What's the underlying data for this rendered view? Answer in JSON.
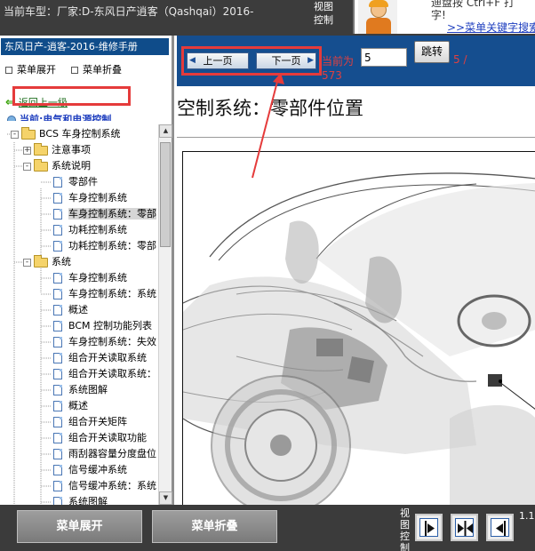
{
  "header": {
    "vehicle_title": "当前车型：厂家:D-东风日产逍客（Qashqai）2016-",
    "view_control": "视图控制",
    "promo_text": "迪盘按 Ctrl+F 打\n字!",
    "promo_link": ">>菜单关键字搜索"
  },
  "left_panel": {
    "manual_title": "东风日产-逍客-2016-维修手册",
    "menu_expand": "菜单展开",
    "menu_collapse": "菜单折叠",
    "back_link": "返回上一级",
    "current_link": "当前:电气和电源控制",
    "tree": [
      {
        "label": "BCS 车身控制系统",
        "type": "folder",
        "level": 0,
        "toggle": "-"
      },
      {
        "label": "注意事项",
        "type": "folder",
        "level": 1,
        "toggle": "+"
      },
      {
        "label": "系统说明",
        "type": "folder",
        "level": 1,
        "toggle": "-"
      },
      {
        "label": "零部件",
        "type": "doc",
        "level": 2
      },
      {
        "label": "车身控制系统",
        "type": "doc",
        "level": 2
      },
      {
        "label": "车身控制系统：零部",
        "type": "doc",
        "level": 2,
        "selected": true
      },
      {
        "label": "功耗控制系统",
        "type": "doc",
        "level": 2
      },
      {
        "label": "功耗控制系统：零部",
        "type": "doc",
        "level": 2
      },
      {
        "label": "系统",
        "type": "folder",
        "level": 1,
        "toggle": "-"
      },
      {
        "label": "车身控制系统",
        "type": "doc",
        "level": 2
      },
      {
        "label": "车身控制系统：系统",
        "type": "doc",
        "level": 2
      },
      {
        "label": "概述",
        "type": "doc",
        "level": 2
      },
      {
        "label": "BCM 控制功能列表",
        "type": "doc",
        "level": 2
      },
      {
        "label": "车身控制系统：失效",
        "type": "doc",
        "level": 2
      },
      {
        "label": "组合开关读取系统",
        "type": "doc",
        "level": 2
      },
      {
        "label": "组合开关读取系统：",
        "type": "doc",
        "level": 2
      },
      {
        "label": "系统图解",
        "type": "doc",
        "level": 2
      },
      {
        "label": "概述",
        "type": "doc",
        "level": 2
      },
      {
        "label": "组合开关矩阵",
        "type": "doc",
        "level": 2
      },
      {
        "label": "组合开关读取功能",
        "type": "doc",
        "level": 2
      },
      {
        "label": "雨刮器容量分度盘位",
        "type": "doc",
        "level": 2
      },
      {
        "label": "信号缓冲系统",
        "type": "doc",
        "level": 2
      },
      {
        "label": "信号缓冲系统：系统",
        "type": "doc",
        "level": 2
      },
      {
        "label": "系统图解",
        "type": "doc",
        "level": 2
      }
    ]
  },
  "nav": {
    "prev_label": "上一页",
    "next_label": "下一页",
    "current_label": "当前为",
    "current_page": "5",
    "jump_label": "跳转",
    "total_a": "5 /",
    "total_b": "573"
  },
  "content": {
    "heading": "空制系统：零部件位置"
  },
  "bottom": {
    "expand_label": "菜单展开",
    "collapse_label": "菜单折叠",
    "view_control": "视图控制",
    "version": "1.1"
  },
  "colors": {
    "header_bg": "#3c3c3c",
    "nav_bg": "#154e8f",
    "title_bg": "#0f4c8a",
    "highlight": "#e53b3b",
    "page_text": "#e04040"
  },
  "icons": [
    "square-icon",
    "back-arrow-icon",
    "globe-icon",
    "folder-icon",
    "document-icon",
    "expand-toggle-icon",
    "scroll-up-icon",
    "scroll-down-icon",
    "prev-arrow-icon",
    "next-arrow-icon",
    "view-left-icon",
    "view-split-icon",
    "view-right-icon"
  ]
}
